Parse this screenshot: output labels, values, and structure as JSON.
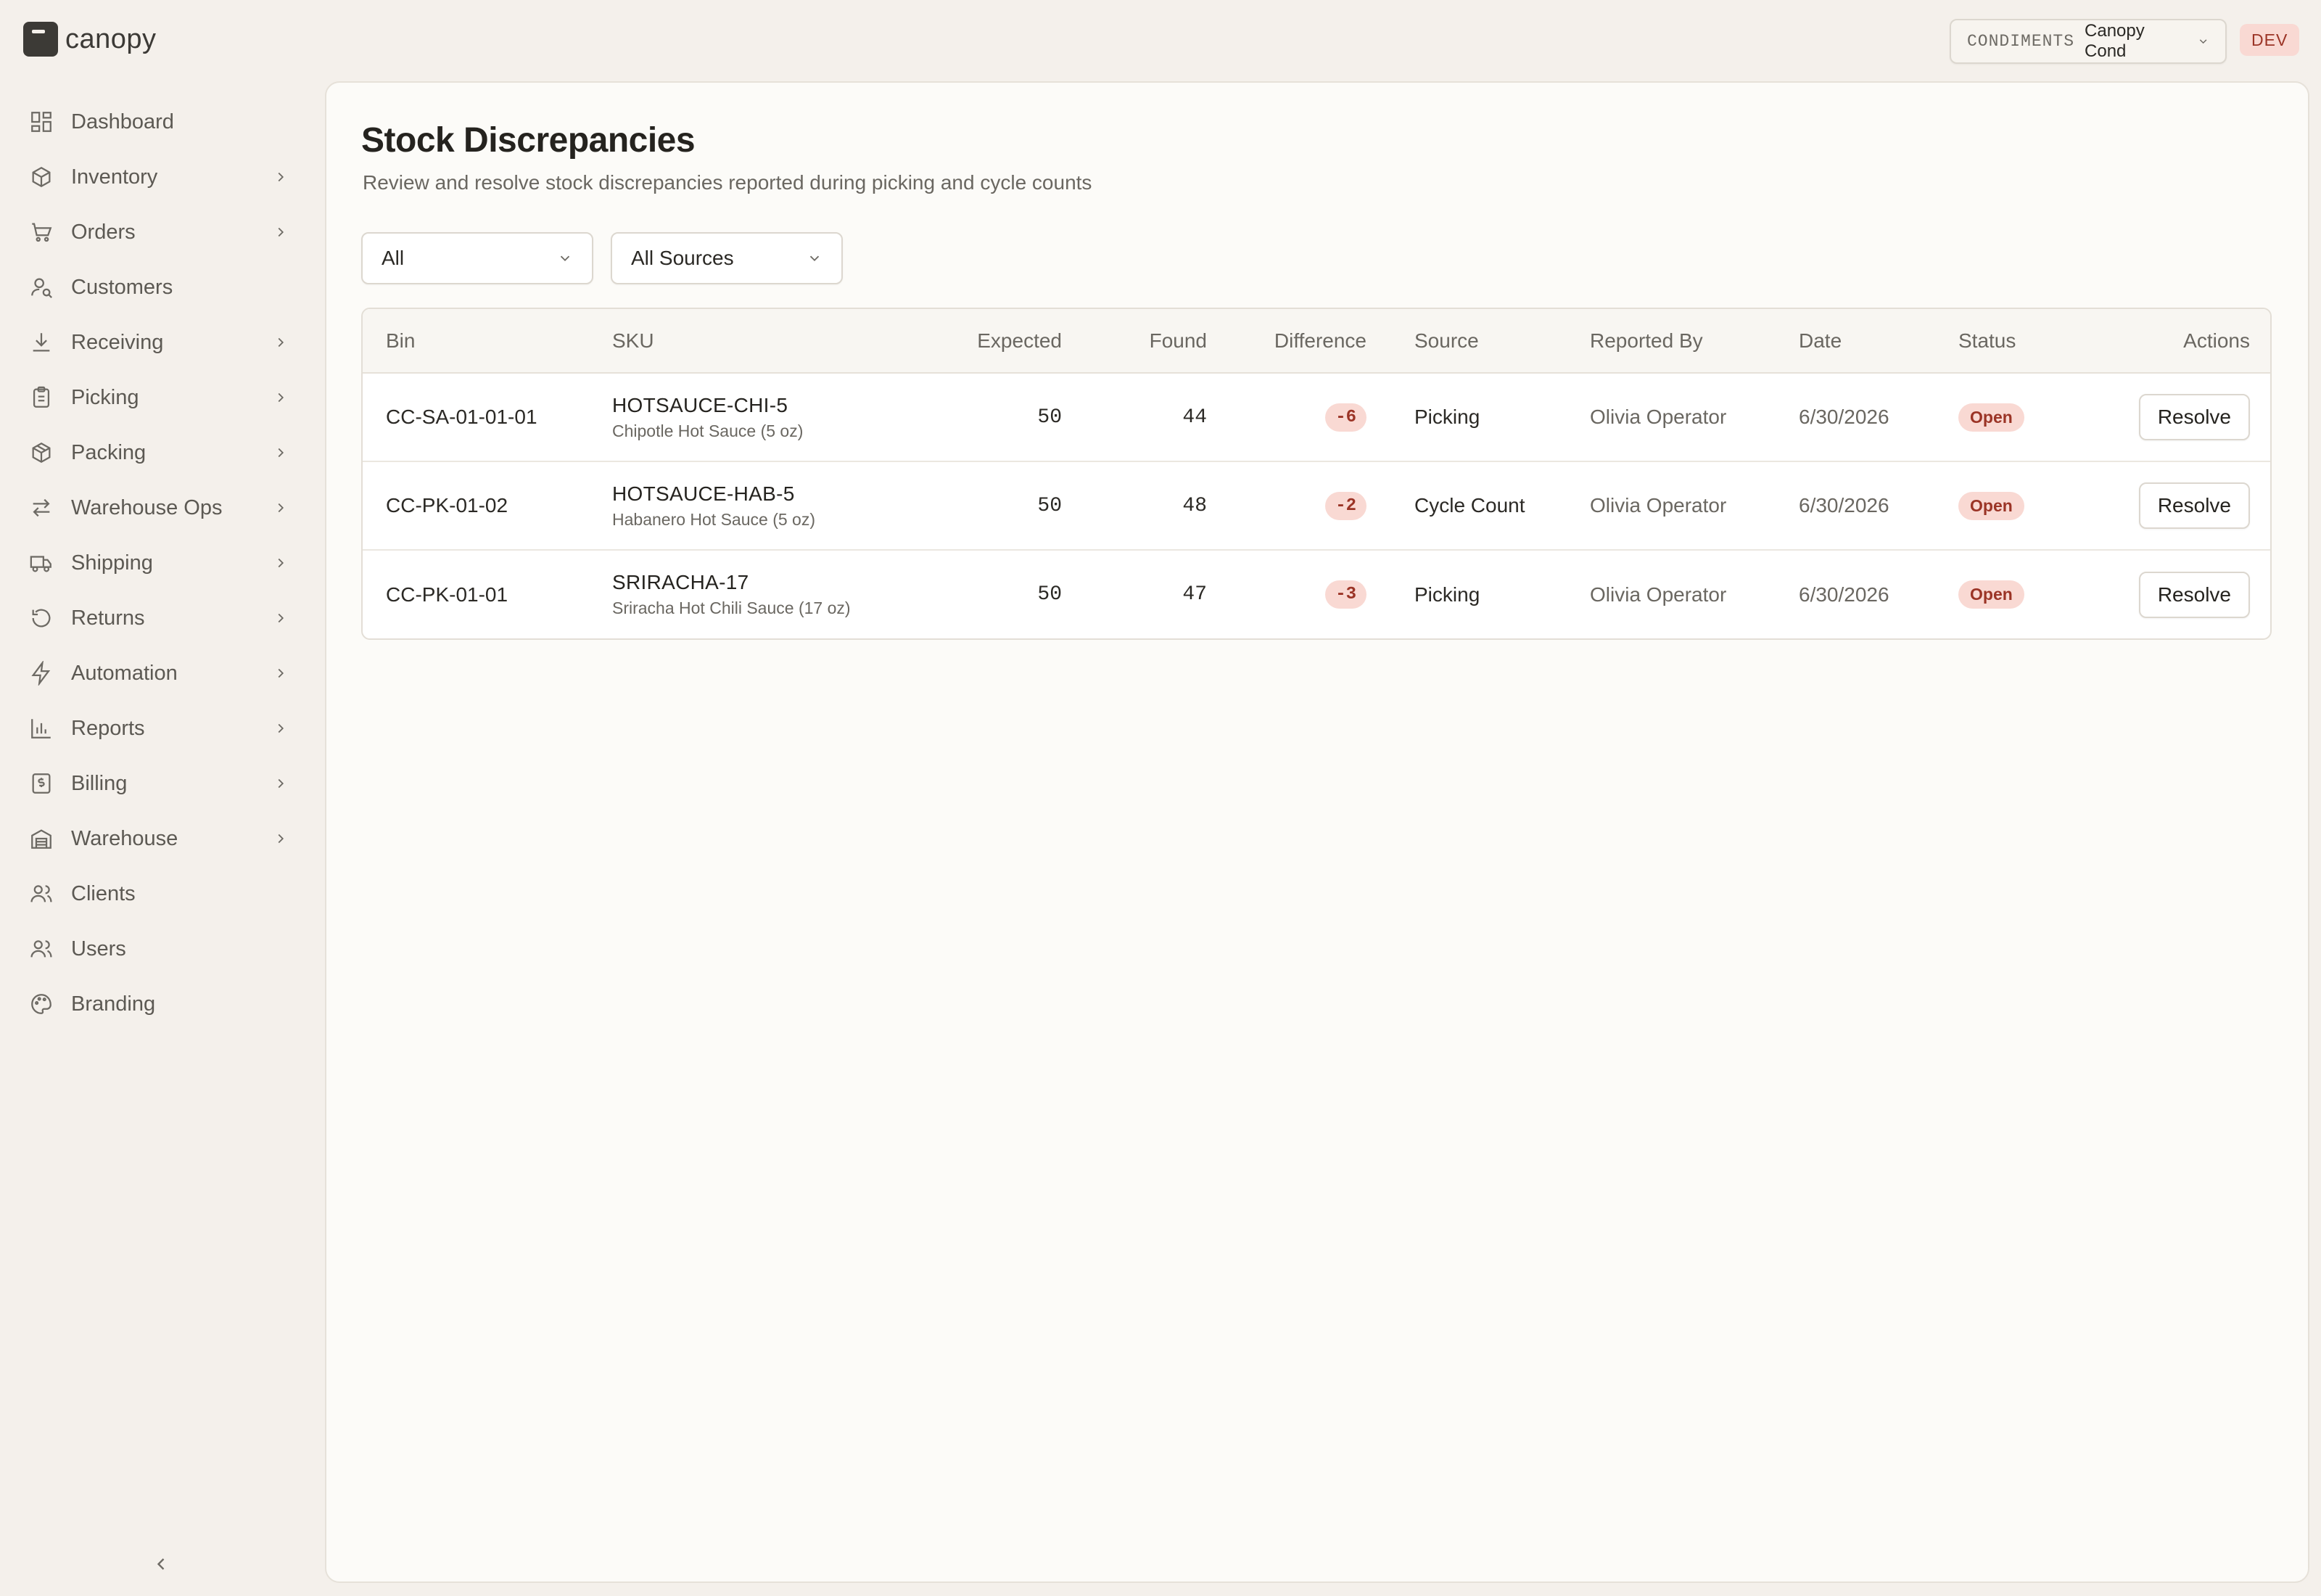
{
  "app": {
    "name": "canopy"
  },
  "tenant": {
    "code": "CONDIMENTS",
    "name": "Canopy Cond"
  },
  "env_badge": "DEV",
  "sidebar": {
    "items": [
      {
        "label": "Dashboard",
        "icon": "dashboard-icon",
        "has_children": false
      },
      {
        "label": "Inventory",
        "icon": "box-icon",
        "has_children": true
      },
      {
        "label": "Orders",
        "icon": "cart-icon",
        "has_children": true
      },
      {
        "label": "Customers",
        "icon": "customer-icon",
        "has_children": false
      },
      {
        "label": "Receiving",
        "icon": "download-icon",
        "has_children": true
      },
      {
        "label": "Picking",
        "icon": "clipboard-icon",
        "has_children": true
      },
      {
        "label": "Packing",
        "icon": "package-icon",
        "has_children": true
      },
      {
        "label": "Warehouse Ops",
        "icon": "swap-icon",
        "has_children": true
      },
      {
        "label": "Shipping",
        "icon": "truck-icon",
        "has_children": true
      },
      {
        "label": "Returns",
        "icon": "rotate-icon",
        "has_children": true
      },
      {
        "label": "Automation",
        "icon": "bolt-icon",
        "has_children": true
      },
      {
        "label": "Reports",
        "icon": "bar-chart-icon",
        "has_children": true
      },
      {
        "label": "Billing",
        "icon": "receipt-icon",
        "has_children": true
      },
      {
        "label": "Warehouse",
        "icon": "warehouse-icon",
        "has_children": true
      },
      {
        "label": "Clients",
        "icon": "users-icon",
        "has_children": false
      },
      {
        "label": "Users",
        "icon": "users-icon",
        "has_children": false
      },
      {
        "label": "Branding",
        "icon": "palette-icon",
        "has_children": false
      }
    ]
  },
  "page": {
    "title": "Stock Discrepancies",
    "subtitle": "Review and resolve stock discrepancies reported during picking and cycle counts"
  },
  "filters": {
    "status": "All",
    "source": "All Sources"
  },
  "table": {
    "headers": {
      "bin": "Bin",
      "sku": "SKU",
      "expected": "Expected",
      "found": "Found",
      "difference": "Difference",
      "source": "Source",
      "reported_by": "Reported By",
      "date": "Date",
      "status": "Status",
      "actions": "Actions"
    },
    "rows": [
      {
        "bin": "CC-SA-01-01-01",
        "sku": "HOTSAUCE-CHI-5",
        "product": "Chipotle Hot Sauce (5 oz)",
        "expected": "50",
        "found": "44",
        "difference": "-6",
        "source": "Picking",
        "reported_by": "Olivia Operator",
        "date": "6/30/2026",
        "status": "Open",
        "action": "Resolve"
      },
      {
        "bin": "CC-PK-01-02",
        "sku": "HOTSAUCE-HAB-5",
        "product": "Habanero Hot Sauce (5 oz)",
        "expected": "50",
        "found": "48",
        "difference": "-2",
        "source": "Cycle Count",
        "reported_by": "Olivia Operator",
        "date": "6/30/2026",
        "status": "Open",
        "action": "Resolve"
      },
      {
        "bin": "CC-PK-01-01",
        "sku": "SRIRACHA-17",
        "product": "Sriracha Hot Chili Sauce (17 oz)",
        "expected": "50",
        "found": "47",
        "difference": "-3",
        "source": "Picking",
        "reported_by": "Olivia Operator",
        "date": "6/30/2026",
        "status": "Open",
        "action": "Resolve"
      }
    ]
  },
  "colors": {
    "accent_danger_bg": "#f9d9d3",
    "accent_danger_text": "#9b3426",
    "sidebar_bg": "#f4f0eb",
    "panel_bg": "#fcfbf8"
  }
}
